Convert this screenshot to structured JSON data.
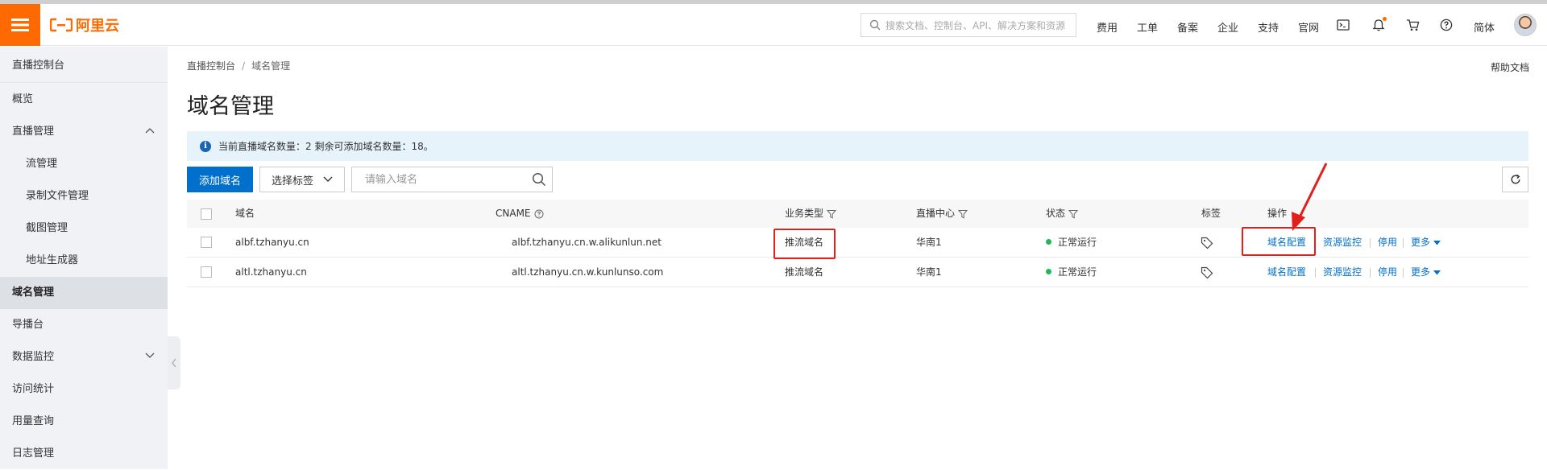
{
  "header": {
    "logo_text": "阿里云",
    "search_placeholder": "搜索文档、控制台、API、解决方案和资源",
    "nav": [
      "费用",
      "工单",
      "备案",
      "企业",
      "支持",
      "官网"
    ],
    "lang": "简体",
    "brand_color": "#ff6a00"
  },
  "sidebar": {
    "title": "直播控制台",
    "items": [
      {
        "label": "概览"
      },
      {
        "label": "直播管理"
      },
      {
        "label": "流管理"
      },
      {
        "label": "录制文件管理"
      },
      {
        "label": "截图管理"
      },
      {
        "label": "地址生成器"
      },
      {
        "label": "域名管理"
      },
      {
        "label": "导播台"
      },
      {
        "label": "数据监控"
      },
      {
        "label": "访问统计"
      },
      {
        "label": "用量查询"
      },
      {
        "label": "日志管理"
      }
    ]
  },
  "main": {
    "breadcrumb": [
      "直播控制台",
      "/",
      "域名管理"
    ],
    "help_doc": "帮助文档",
    "title": "域名管理",
    "notice": "当前直播域名数量：2 剩余可添加域名数量：18。",
    "add_button": "添加域名",
    "tag_select": "选择标签",
    "search_placeholder": "请输入域名"
  },
  "table": {
    "columns": [
      "域名",
      "CNAME",
      "业务类型",
      "直播中心",
      "状态",
      "标签",
      "操作"
    ],
    "rows": [
      {
        "domain": "albf.tzhanyu.cn",
        "cname": "albf.tzhanyu.cn.w.alikunlun.net",
        "type": "推流域名",
        "center": "华南1",
        "status": "正常运行"
      },
      {
        "domain": "altl.tzhanyu.cn",
        "cname": "altl.tzhanyu.cn.w.kunlunso.com",
        "type": "推流域名",
        "center": "华南1",
        "status": "正常运行"
      }
    ],
    "actions": {
      "config": "域名配置",
      "monitor": "资源监控",
      "disable": "停用",
      "more": "更多"
    },
    "link_color": "#0070cc",
    "status_color": "#20b759"
  },
  "annotation_color": "#e0201b"
}
